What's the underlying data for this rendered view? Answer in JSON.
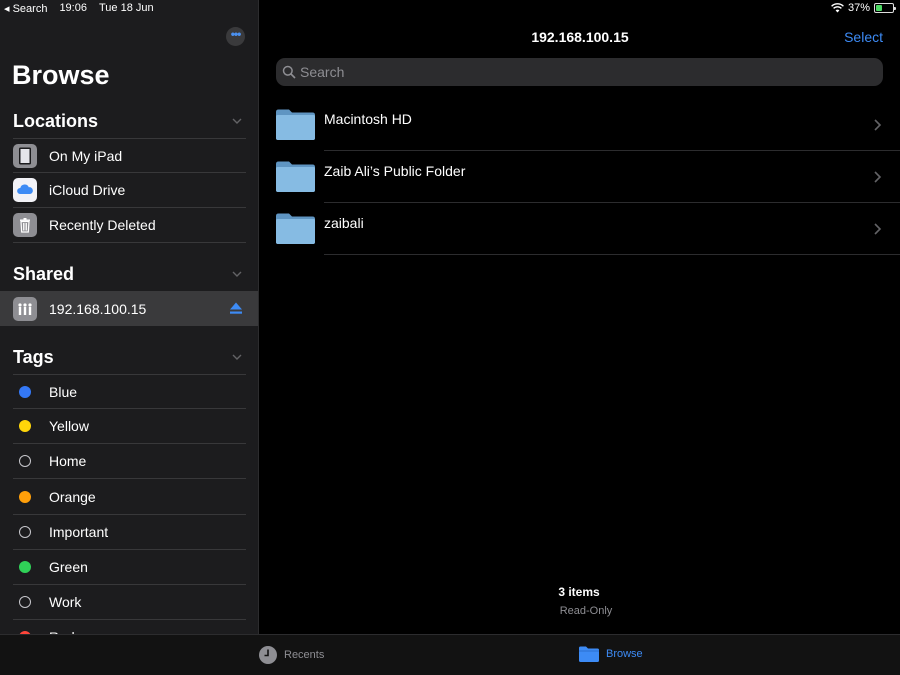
{
  "status": {
    "back_app": "Search",
    "time": "19:06",
    "date": "Tue 18 Jun",
    "battery": "37%",
    "battery_level": 0.37
  },
  "sidebar": {
    "title": "Browse",
    "locations": {
      "heading": "Locations",
      "items": [
        {
          "label": "On My iPad",
          "icon": "ipad-icon"
        },
        {
          "label": "iCloud Drive",
          "icon": "icloud-icon"
        },
        {
          "label": "Recently Deleted",
          "icon": "trash-icon"
        }
      ]
    },
    "shared": {
      "heading": "Shared",
      "items": [
        {
          "label": "192.168.100.15",
          "icon": "server-icon"
        }
      ]
    },
    "tags": {
      "heading": "Tags",
      "items": [
        {
          "label": "Blue",
          "color": "#3478f6"
        },
        {
          "label": "Yellow",
          "color": "#ffd60a"
        },
        {
          "label": "Home",
          "color": ""
        },
        {
          "label": "Orange",
          "color": "#ff9f0a"
        },
        {
          "label": "Important",
          "color": ""
        },
        {
          "label": "Green",
          "color": "#30d158"
        },
        {
          "label": "Work",
          "color": ""
        },
        {
          "label": "Red",
          "color": "#ff453a"
        }
      ]
    }
  },
  "main": {
    "title": "192.168.100.15",
    "select_label": "Select",
    "search_placeholder": "Search",
    "folders": [
      {
        "name": "Macintosh HD"
      },
      {
        "name": "Zaib Ali’s Public Folder"
      },
      {
        "name": "zaibali"
      }
    ],
    "item_count": "3 items",
    "access": "Read-Only"
  },
  "tabbar": {
    "recents": "Recents",
    "browse": "Browse"
  },
  "colors": {
    "accent": "#3d8bf5",
    "sidebar_bg": "#1c1c1e",
    "selected_bg": "#3a3a3c",
    "folder": "#7fb3dc"
  }
}
